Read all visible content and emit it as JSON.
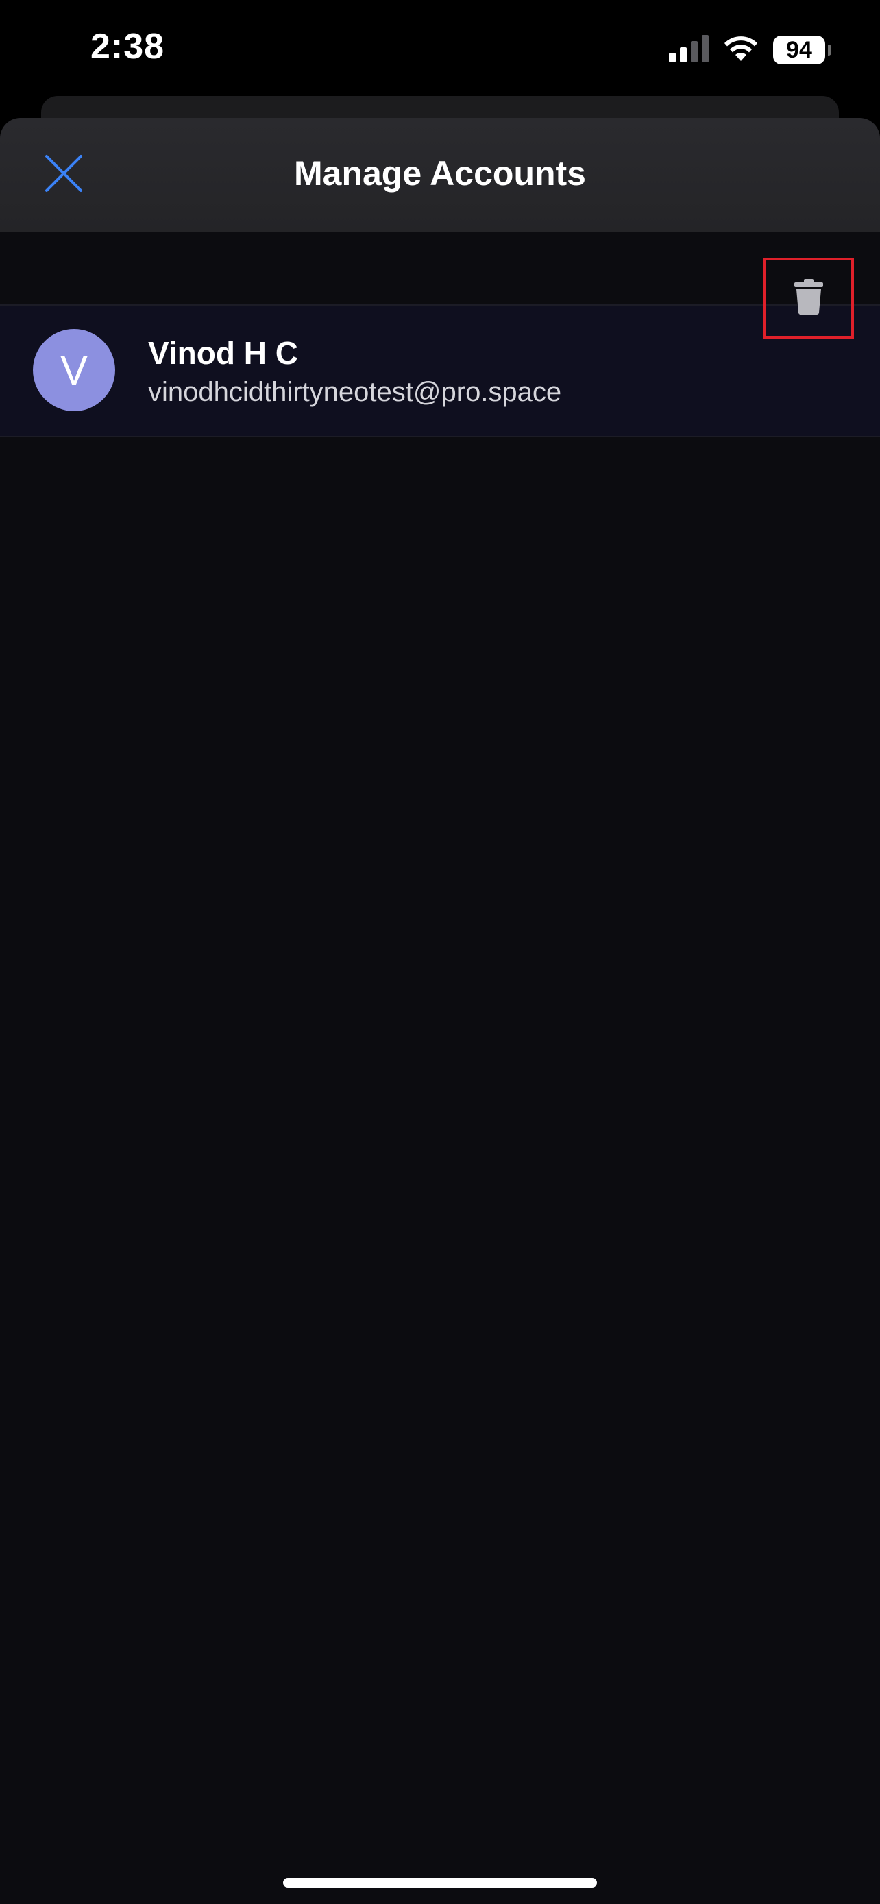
{
  "status_bar": {
    "time": "2:38",
    "battery_percent": "94",
    "signal_icon": "cellular-signal-icon",
    "wifi_icon": "wifi-icon"
  },
  "nav": {
    "title": "Manage Accounts",
    "close_icon": "close-icon"
  },
  "accounts": [
    {
      "initial": "V",
      "name": "Vinod H C",
      "email": "vinodhcidthirtyneotest@pro.space",
      "delete_icon": "trash-icon"
    }
  ],
  "colors": {
    "accent_close": "#3b82f6",
    "avatar_bg": "#8c90e0",
    "highlight_border": "#e0202a",
    "sheet_bg": "#0c0c10",
    "row_bg": "#0f0f1f"
  }
}
